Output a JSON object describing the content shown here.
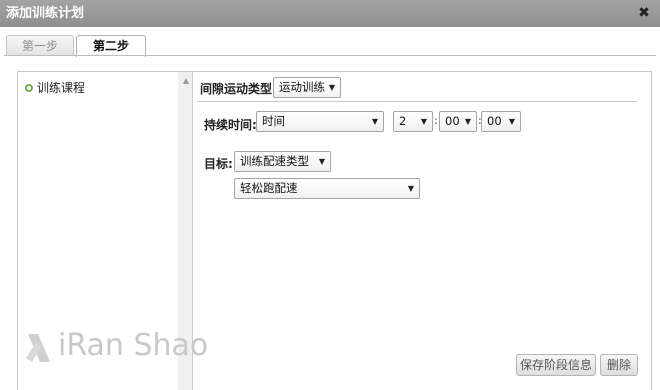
{
  "window": {
    "title": "添加训练计划",
    "close_glyph": "✖"
  },
  "tabs": [
    {
      "label": "第一步",
      "active": false
    },
    {
      "label": "第二步",
      "active": true
    }
  ],
  "tree": {
    "items": [
      {
        "label": "训练课程"
      }
    ]
  },
  "form": {
    "interval_type": {
      "label": "间隙运动类型",
      "value": "运动训练"
    },
    "duration": {
      "label": "持续时间:",
      "mode": "时间",
      "hours": "2",
      "minutes": "00",
      "seconds": "00",
      "separator": ":"
    },
    "target": {
      "label": "目标:",
      "type": "训练配速类型",
      "pace": "轻松跑配速"
    }
  },
  "buttons": {
    "save": "保存阶段信息",
    "delete": "删除"
  },
  "watermark": "iRan Shao",
  "colors": {
    "titlebar": "#999999",
    "bullet": "#7aa84a"
  }
}
